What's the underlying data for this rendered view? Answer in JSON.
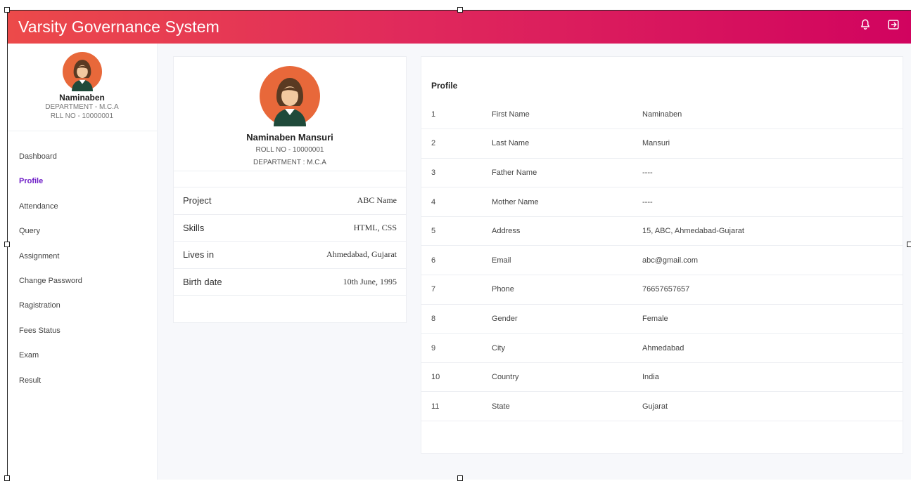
{
  "app": {
    "title": "Varsity Governance System"
  },
  "header": {
    "icons": [
      "bell-icon",
      "logout-icon"
    ]
  },
  "sidebar": {
    "user": {
      "name": "Naminaben",
      "department": "DEPARTMENT - M.C.A",
      "roll": "RLL NO - 10000001"
    },
    "items": [
      {
        "label": "Dashboard"
      },
      {
        "label": "Profile",
        "active": true
      },
      {
        "label": "Attendance"
      },
      {
        "label": "Query"
      },
      {
        "label": "Assignment"
      },
      {
        "label": "Change Password"
      },
      {
        "label": "Ragistration"
      },
      {
        "label": "Fees Status"
      },
      {
        "label": "Exam"
      },
      {
        "label": "Result"
      }
    ]
  },
  "profile_card": {
    "name": "Naminaben Mansuri",
    "roll": "ROLL NO - 10000001",
    "department": "DEPARTMENT : M.C.A",
    "info": [
      {
        "key": "Project",
        "value": "ABC Name"
      },
      {
        "key": "Skills",
        "value": "HTML, CSS"
      },
      {
        "key": "Lives in",
        "value": "Ahmedabad, Gujarat"
      },
      {
        "key": "Birth date",
        "value": "10th June, 1995"
      }
    ]
  },
  "details": {
    "title": "Profile",
    "rows": [
      {
        "no": "1",
        "field": "First Name",
        "value": "Naminaben"
      },
      {
        "no": "2",
        "field": "Last Name",
        "value": "Mansuri"
      },
      {
        "no": "3",
        "field": "Father Name",
        "value": "----"
      },
      {
        "no": "4",
        "field": "Mother Name",
        "value": "----"
      },
      {
        "no": "5",
        "field": "Address",
        "value": "15, ABC, Ahmedabad-Gujarat"
      },
      {
        "no": "6",
        "field": "Email",
        "value": "abc@gmail.com"
      },
      {
        "no": "7",
        "field": "Phone",
        "value": "76657657657"
      },
      {
        "no": "8",
        "field": "Gender",
        "value": "Female"
      },
      {
        "no": "9",
        "field": "City",
        "value": "Ahmedabad"
      },
      {
        "no": "10",
        "field": "Country",
        "value": "India"
      },
      {
        "no": "11",
        "field": "State",
        "value": "Gujarat"
      }
    ]
  },
  "colors": {
    "header_start": "#ec4a4a",
    "header_end": "#d1035f",
    "active_menu": "#6f1fc7",
    "avatar_bg": "#e8683a"
  }
}
